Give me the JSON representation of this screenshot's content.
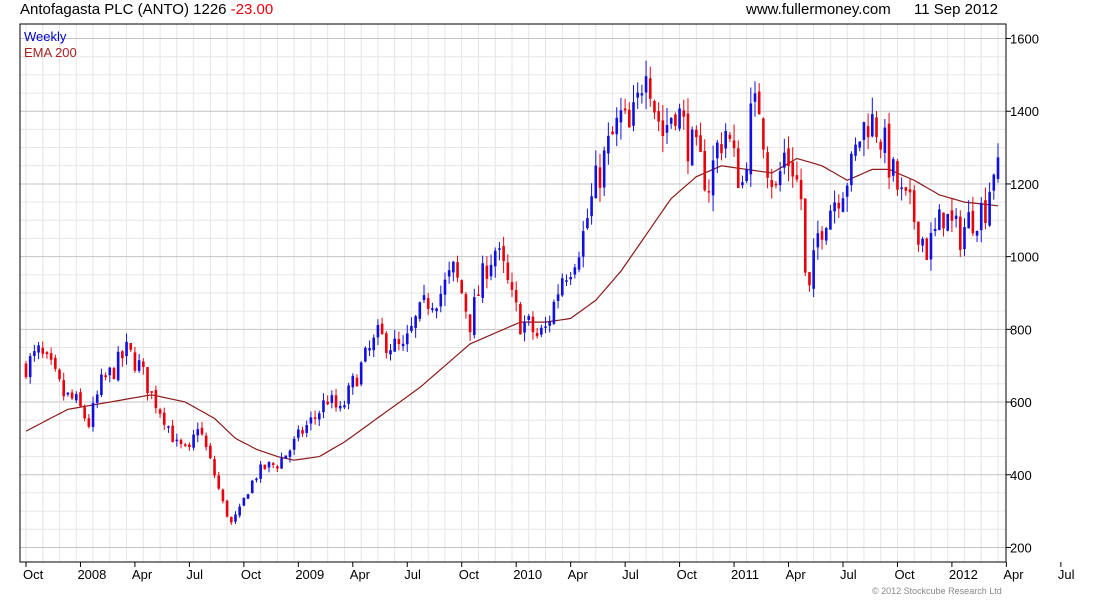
{
  "header": {
    "symbol": "Antofagasta PLC (ANTO) 1226",
    "change": "-23.00",
    "site": "www.fullermoney.com",
    "date": "11 Sep 2012"
  },
  "legend": {
    "series1": "Weekly",
    "series2": "EMA 200"
  },
  "copyright": "© 2012 Stockcube Research Ltd",
  "colors": {
    "up": "#1010e0",
    "down": "#e8000b",
    "ema": "#8b1a1a",
    "grid": "#cccccc"
  },
  "chart_data": {
    "type": "candlestick",
    "interval": "weekly",
    "ylim": [
      160,
      1640
    ],
    "yticks": [
      200,
      400,
      600,
      800,
      1000,
      1200,
      1400,
      1600
    ],
    "xticks": [
      "Oct",
      "2008",
      "Apr",
      "Jul",
      "Oct",
      "2009",
      "Apr",
      "Jul",
      "Oct",
      "2010",
      "Apr",
      "Jul",
      "Oct",
      "2011",
      "Apr",
      "Jul",
      "Oct",
      "2012",
      "Apr",
      "Jul"
    ],
    "grid": true,
    "close_anchors": [
      [
        0,
        700
      ],
      [
        3,
        735
      ],
      [
        6,
        690
      ],
      [
        9,
        620
      ],
      [
        12,
        600
      ],
      [
        15,
        540
      ],
      [
        18,
        650
      ],
      [
        21,
        690
      ],
      [
        24,
        740
      ],
      [
        27,
        700
      ],
      [
        30,
        620
      ],
      [
        33,
        560
      ],
      [
        36,
        480
      ],
      [
        39,
        460
      ],
      [
        41,
        540
      ],
      [
        43,
        470
      ],
      [
        45,
        400
      ],
      [
        47,
        320
      ],
      [
        49,
        265
      ],
      [
        51,
        300
      ],
      [
        53,
        360
      ],
      [
        55,
        400
      ],
      [
        57,
        420
      ],
      [
        60,
        430
      ],
      [
        63,
        470
      ],
      [
        66,
        520
      ],
      [
        69,
        560
      ],
      [
        72,
        610
      ],
      [
        75,
        570
      ],
      [
        78,
        650
      ],
      [
        81,
        720
      ],
      [
        84,
        780
      ],
      [
        87,
        760
      ],
      [
        90,
        740
      ],
      [
        93,
        820
      ],
      [
        96,
        880
      ],
      [
        99,
        900
      ],
      [
        102,
        960
      ],
      [
        104,
        900
      ],
      [
        106,
        820
      ],
      [
        108,
        900
      ],
      [
        110,
        980
      ],
      [
        112,
        1020
      ],
      [
        114,
        960
      ],
      [
        116,
        880
      ],
      [
        118,
        820
      ],
      [
        120,
        810
      ],
      [
        122,
        780
      ],
      [
        124,
        800
      ],
      [
        126,
        870
      ],
      [
        128,
        950
      ],
      [
        130,
        980
      ],
      [
        133,
        1060
      ],
      [
        136,
        1200
      ],
      [
        139,
        1300
      ],
      [
        142,
        1380
      ],
      [
        144,
        1340
      ],
      [
        146,
        1420
      ],
      [
        148,
        1560
      ],
      [
        150,
        1420
      ],
      [
        152,
        1340
      ],
      [
        155,
        1420
      ],
      [
        158,
        1320
      ],
      [
        161,
        1250
      ],
      [
        163,
        1200
      ],
      [
        165,
        1300
      ],
      [
        167,
        1350
      ],
      [
        169,
        1260
      ],
      [
        171,
        1200
      ],
      [
        173,
        1380
      ],
      [
        175,
        1420
      ],
      [
        177,
        1260
      ],
      [
        179,
        1180
      ],
      [
        181,
        1280
      ],
      [
        183,
        1250
      ],
      [
        185,
        1160
      ],
      [
        186,
        940
      ],
      [
        187,
        900
      ],
      [
        189,
        1060
      ],
      [
        191,
        1120
      ],
      [
        193,
        1160
      ],
      [
        195,
        1200
      ],
      [
        197,
        1240
      ],
      [
        199,
        1330
      ],
      [
        201,
        1380
      ],
      [
        203,
        1360
      ],
      [
        205,
        1300
      ],
      [
        207,
        1220
      ],
      [
        209,
        1160
      ],
      [
        211,
        1130
      ],
      [
        213,
        1080
      ],
      [
        215,
        1020
      ],
      [
        217,
        1060
      ],
      [
        219,
        1120
      ],
      [
        221,
        1080
      ],
      [
        223,
        1060
      ],
      [
        225,
        1100
      ],
      [
        227,
        1120
      ],
      [
        229,
        1140
      ],
      [
        231,
        1249
      ],
      [
        232,
        1226
      ]
    ],
    "ema_anchors": [
      [
        0,
        520
      ],
      [
        10,
        580
      ],
      [
        20,
        600
      ],
      [
        30,
        620
      ],
      [
        38,
        600
      ],
      [
        45,
        555
      ],
      [
        50,
        500
      ],
      [
        55,
        470
      ],
      [
        60,
        450
      ],
      [
        64,
        440
      ],
      [
        70,
        450
      ],
      [
        76,
        490
      ],
      [
        82,
        540
      ],
      [
        88,
        590
      ],
      [
        94,
        640
      ],
      [
        100,
        700
      ],
      [
        106,
        760
      ],
      [
        112,
        790
      ],
      [
        118,
        820
      ],
      [
        124,
        820
      ],
      [
        130,
        830
      ],
      [
        136,
        880
      ],
      [
        142,
        960
      ],
      [
        148,
        1060
      ],
      [
        154,
        1160
      ],
      [
        160,
        1220
      ],
      [
        166,
        1250
      ],
      [
        172,
        1240
      ],
      [
        178,
        1230
      ],
      [
        184,
        1270
      ],
      [
        190,
        1250
      ],
      [
        196,
        1210
      ],
      [
        202,
        1240
      ],
      [
        206,
        1240
      ],
      [
        212,
        1210
      ],
      [
        218,
        1170
      ],
      [
        224,
        1150
      ],
      [
        232,
        1140
      ]
    ],
    "weeks": 233
  }
}
